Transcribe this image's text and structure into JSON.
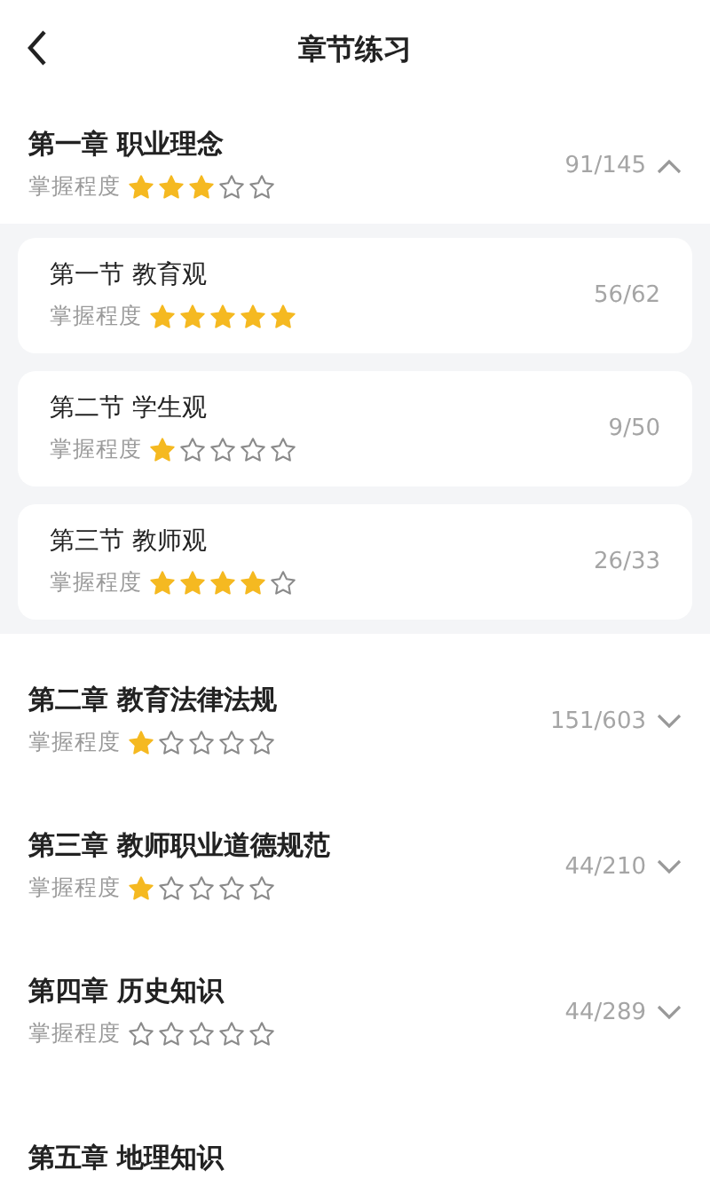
{
  "header": {
    "title": "章节练习"
  },
  "chapters": [
    {
      "title": "第一章 职业理念",
      "mastery_label": "掌握程度",
      "stars": 3,
      "progress": "91/145",
      "expanded": true,
      "sections": [
        {
          "title": "第一节 教育观",
          "mastery_label": "掌握程度",
          "stars": 5,
          "progress": "56/62"
        },
        {
          "title": "第二节 学生观",
          "mastery_label": "掌握程度",
          "stars": 1,
          "progress": "9/50"
        },
        {
          "title": "第三节 教师观",
          "mastery_label": "掌握程度",
          "stars": 4,
          "progress": "26/33"
        }
      ]
    },
    {
      "title": "第二章 教育法律法规",
      "mastery_label": "掌握程度",
      "stars": 1,
      "progress": "151/603",
      "expanded": false
    },
    {
      "title": "第三章 教师职业道德规范",
      "mastery_label": "掌握程度",
      "stars": 1,
      "progress": "44/210",
      "expanded": false
    },
    {
      "title": "第四章 历史知识",
      "mastery_label": "掌握程度",
      "stars": 0,
      "progress": "44/289",
      "expanded": false
    },
    {
      "title": "第五章 地理知识"
    }
  ]
}
